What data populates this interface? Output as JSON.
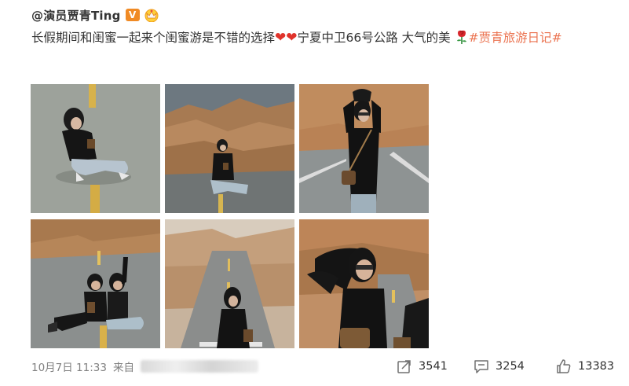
{
  "post": {
    "username": "@演员贾青Ting",
    "verified_badge": "V",
    "badge_icon": "crown-badge-icon",
    "text_main": "长假期间和闺蜜一起来个闺蜜游是不错的选择",
    "hearts": "❤❤",
    "text_after": "宁夏中卫66号公路 大气的美",
    "topic": "#贾青旅游日记#",
    "colors": {
      "topic": "#eb7350",
      "heart": "#e0332b",
      "badge": "#f08a24"
    }
  },
  "photos": [
    {
      "name": "photo-1",
      "icon": "road-sitting-photo"
    },
    {
      "name": "photo-2",
      "icon": "road-mountain-photo"
    },
    {
      "name": "photo-3",
      "icon": "arms-raised-photo"
    },
    {
      "name": "photo-4",
      "icon": "two-friends-photo"
    },
    {
      "name": "photo-5",
      "icon": "road-back-photo"
    },
    {
      "name": "photo-6",
      "icon": "hair-wind-photo"
    }
  ],
  "footer": {
    "date_time": "10月7日 11:33",
    "source_prefix": "来自"
  },
  "actions": {
    "share_count": "3541",
    "comment_count": "3254",
    "like_count": "13383"
  }
}
